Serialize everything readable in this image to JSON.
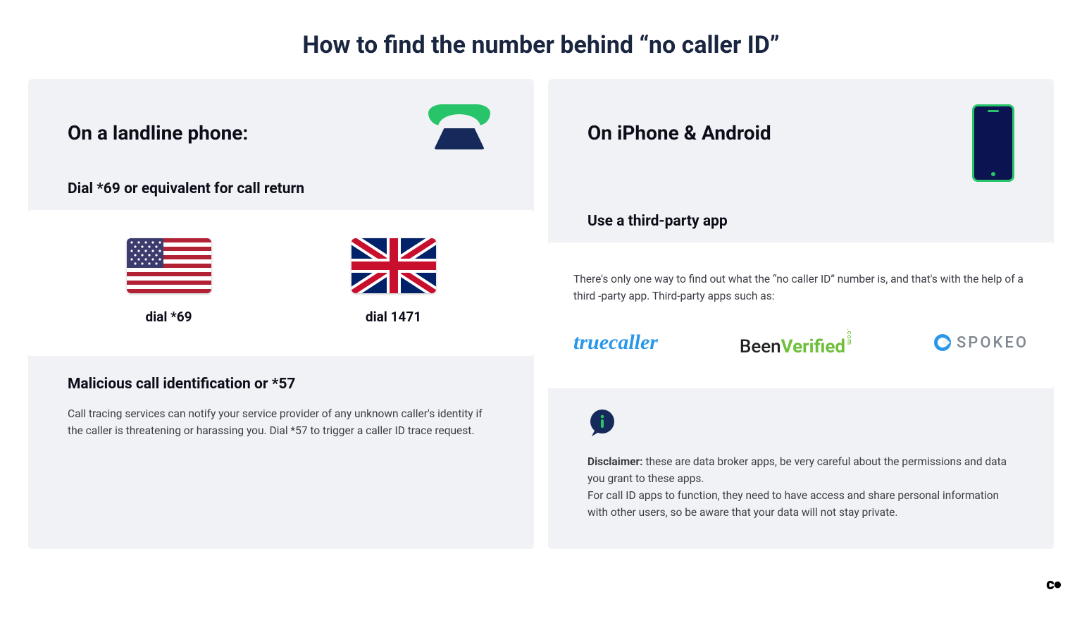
{
  "title": "How to find the number behind “no caller ID”",
  "landline": {
    "heading": "On a landline phone:",
    "sub1": "Dial *69 or equivalent for call return",
    "us_label": "dial *69",
    "uk_label": "dial 1471",
    "sub2": "Malicious call identification or *57",
    "body": "Call tracing services can notify your service provider of any unknown caller's identity if the caller is threatening or harassing you. Dial *57 to trigger a caller ID trace request."
  },
  "mobile": {
    "heading": "On iPhone & Android",
    "sub1": "Use a third-party app",
    "intro": "There's only one way to find out what the “no caller ID” number is, and that's with the help of a third -party app. Third-party apps such as:",
    "apps": {
      "truecaller": "truecaller",
      "beenverified_a": "Been",
      "beenverified_b": "Verified",
      "beenverified_c": ".com",
      "spokeo": "SPOKEO"
    },
    "disclaimer_label": "Disclaimer:",
    "disclaimer_1": " these are data broker apps, be very careful about the permissions and data you grant to these apps.",
    "disclaimer_2": "For call ID apps to function, they need to have access and share personal information with other users, so be aware that your data will not stay private."
  },
  "footer": "c●"
}
